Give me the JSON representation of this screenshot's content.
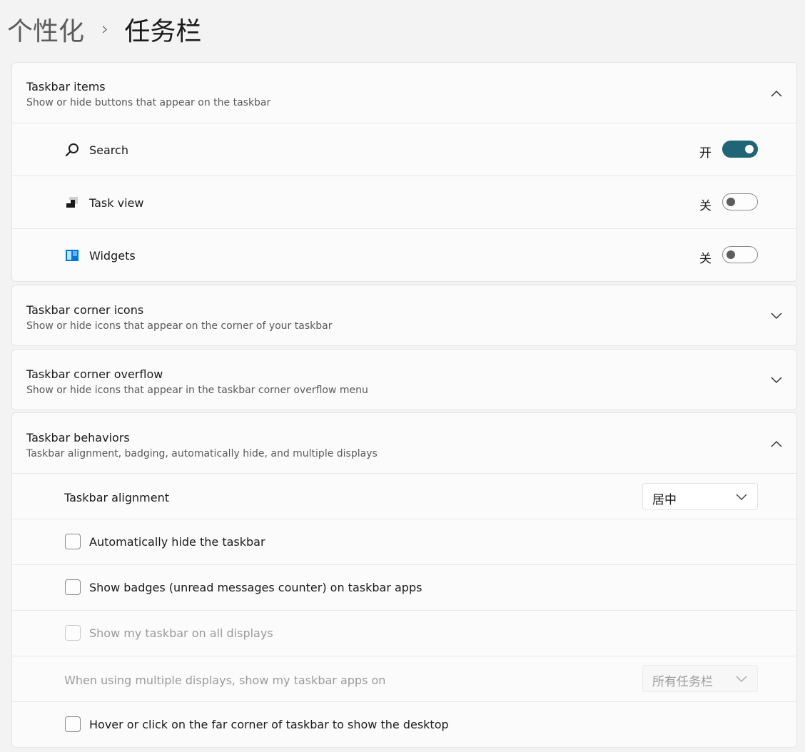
{
  "breadcrumb": {
    "parent": "个性化",
    "separator": "›",
    "current": "任务栏"
  },
  "taskbar_items": {
    "title": "Taskbar items",
    "subtitle": "Show or hide buttons that appear on the taskbar",
    "expanded": true,
    "items": [
      {
        "label": "Search",
        "icon": "search-icon",
        "state": "开",
        "on": true
      },
      {
        "label": "Task view",
        "icon": "task-view-icon",
        "state": "关",
        "on": false
      },
      {
        "label": "Widgets",
        "icon": "widgets-icon",
        "state": "关",
        "on": false
      }
    ]
  },
  "corner_icons": {
    "title": "Taskbar corner icons",
    "subtitle": "Show or hide icons that appear on the corner of your taskbar",
    "expanded": false
  },
  "corner_overflow": {
    "title": "Taskbar corner overflow",
    "subtitle": "Show or hide icons that appear in the taskbar corner overflow menu",
    "expanded": false
  },
  "behaviors": {
    "title": "Taskbar behaviors",
    "subtitle": "Taskbar alignment, badging, automatically hide, and multiple displays",
    "expanded": true,
    "alignment": {
      "label": "Taskbar alignment",
      "value": "居中"
    },
    "auto_hide": {
      "label": "Automatically hide the taskbar",
      "checked": false
    },
    "badges": {
      "label": "Show badges (unread messages counter) on taskbar apps",
      "checked": false
    },
    "all_displays": {
      "label": "Show my taskbar on all displays",
      "checked": false,
      "disabled": true
    },
    "multi_display": {
      "label": "When using multiple displays, show my taskbar apps on",
      "value": "所有任务栏",
      "disabled": true
    },
    "show_desktop": {
      "label": "Hover or click on the far corner of taskbar to show the desktop",
      "checked": false
    }
  },
  "colors": {
    "accent": "#1f6575",
    "background": "#f3f3f3",
    "card": "#fbfbfb",
    "widgets_blue": "#0078d4"
  }
}
